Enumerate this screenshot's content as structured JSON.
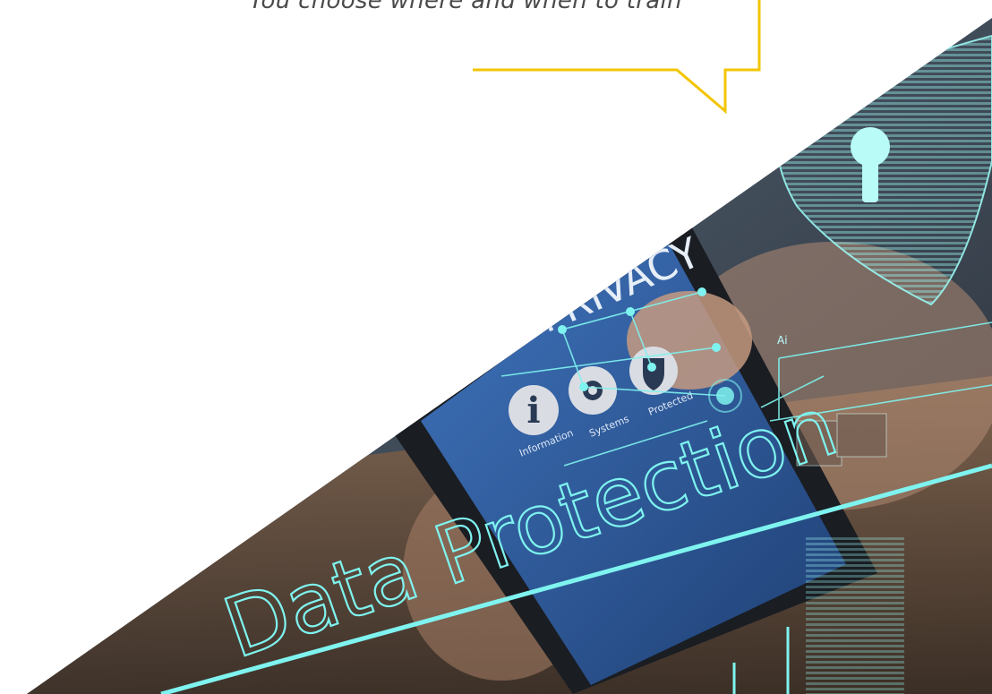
{
  "tagline": "You choose where and when to train",
  "photo": {
    "headline": "Data Protection",
    "screen_word": "PRIVACY",
    "icon_labels": [
      "Information",
      "Systems",
      "Protected"
    ],
    "small_label": "Ai",
    "icons": [
      "info-icon",
      "gear-icon",
      "shield-icon",
      "keyhole-shield-icon"
    ]
  },
  "colors": {
    "callout": "#f2c500",
    "hud": "#7ff3ef",
    "phone_screen": "#2f5fa6"
  }
}
